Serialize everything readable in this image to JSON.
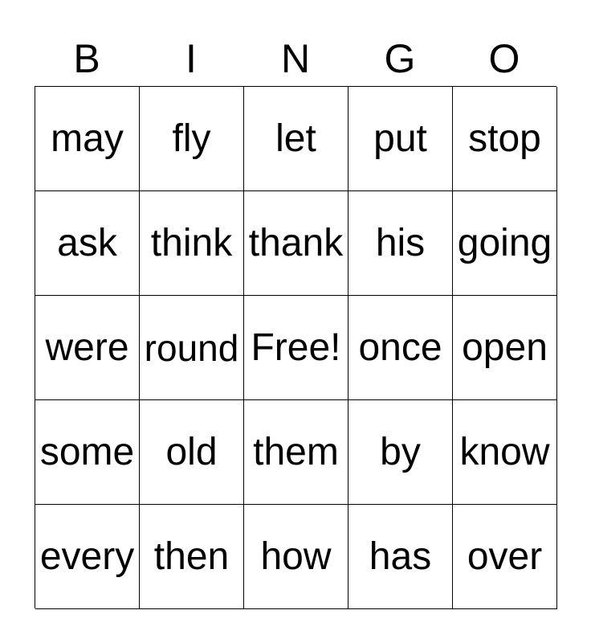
{
  "header": [
    "B",
    "I",
    "N",
    "G",
    "O"
  ],
  "cells": [
    [
      "may",
      "fly",
      "let",
      "put",
      "stop"
    ],
    [
      "ask",
      "think",
      "thank",
      "his",
      "going"
    ],
    [
      "were",
      "round",
      "Free!",
      "once",
      "open"
    ],
    [
      "some",
      "old",
      "them",
      "by",
      "know"
    ],
    [
      "every",
      "then",
      "how",
      "has",
      "over"
    ]
  ]
}
